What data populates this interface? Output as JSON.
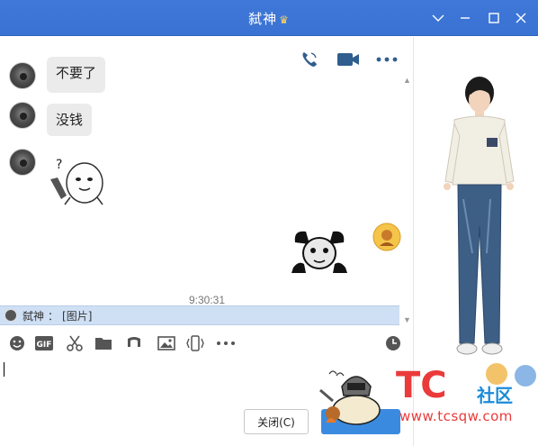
{
  "window": {
    "title": "弑神",
    "controls": [
      "chevron-down-icon",
      "minimize-icon",
      "maximize-icon",
      "close-icon"
    ]
  },
  "header_actions": [
    "phone-icon",
    "video-camera-icon",
    "more-icon"
  ],
  "messages": [
    {
      "sender": "contact",
      "type": "text",
      "text": "不要了"
    },
    {
      "sender": "contact",
      "type": "text",
      "text": "没钱"
    },
    {
      "sender": "contact",
      "type": "sticker",
      "sticker": "panda-knife-sticker"
    },
    {
      "sender": "self",
      "type": "sticker",
      "sticker": "panda-head-sticker"
    }
  ],
  "timestamp": "9:30:31",
  "notification": {
    "name": "弑神",
    "separator": "：",
    "content": "[图片]"
  },
  "toolbar": [
    "emoji-icon",
    "gif-icon",
    "scissors-icon",
    "folder-icon",
    "music-icon",
    "image-icon",
    "shake-icon",
    "more-icon",
    "history-clock-icon"
  ],
  "buttons": {
    "close": "关闭(C)"
  },
  "watermark": {
    "brand": "TC",
    "community": "社区",
    "url": "www.tcsqw.com"
  },
  "colors": {
    "titlebar": "#3a72d3",
    "bubble": "#ebebeb",
    "notify": "#cfe0f5",
    "send": "#3a8be0",
    "watermark_red": "#ea3a3a"
  }
}
